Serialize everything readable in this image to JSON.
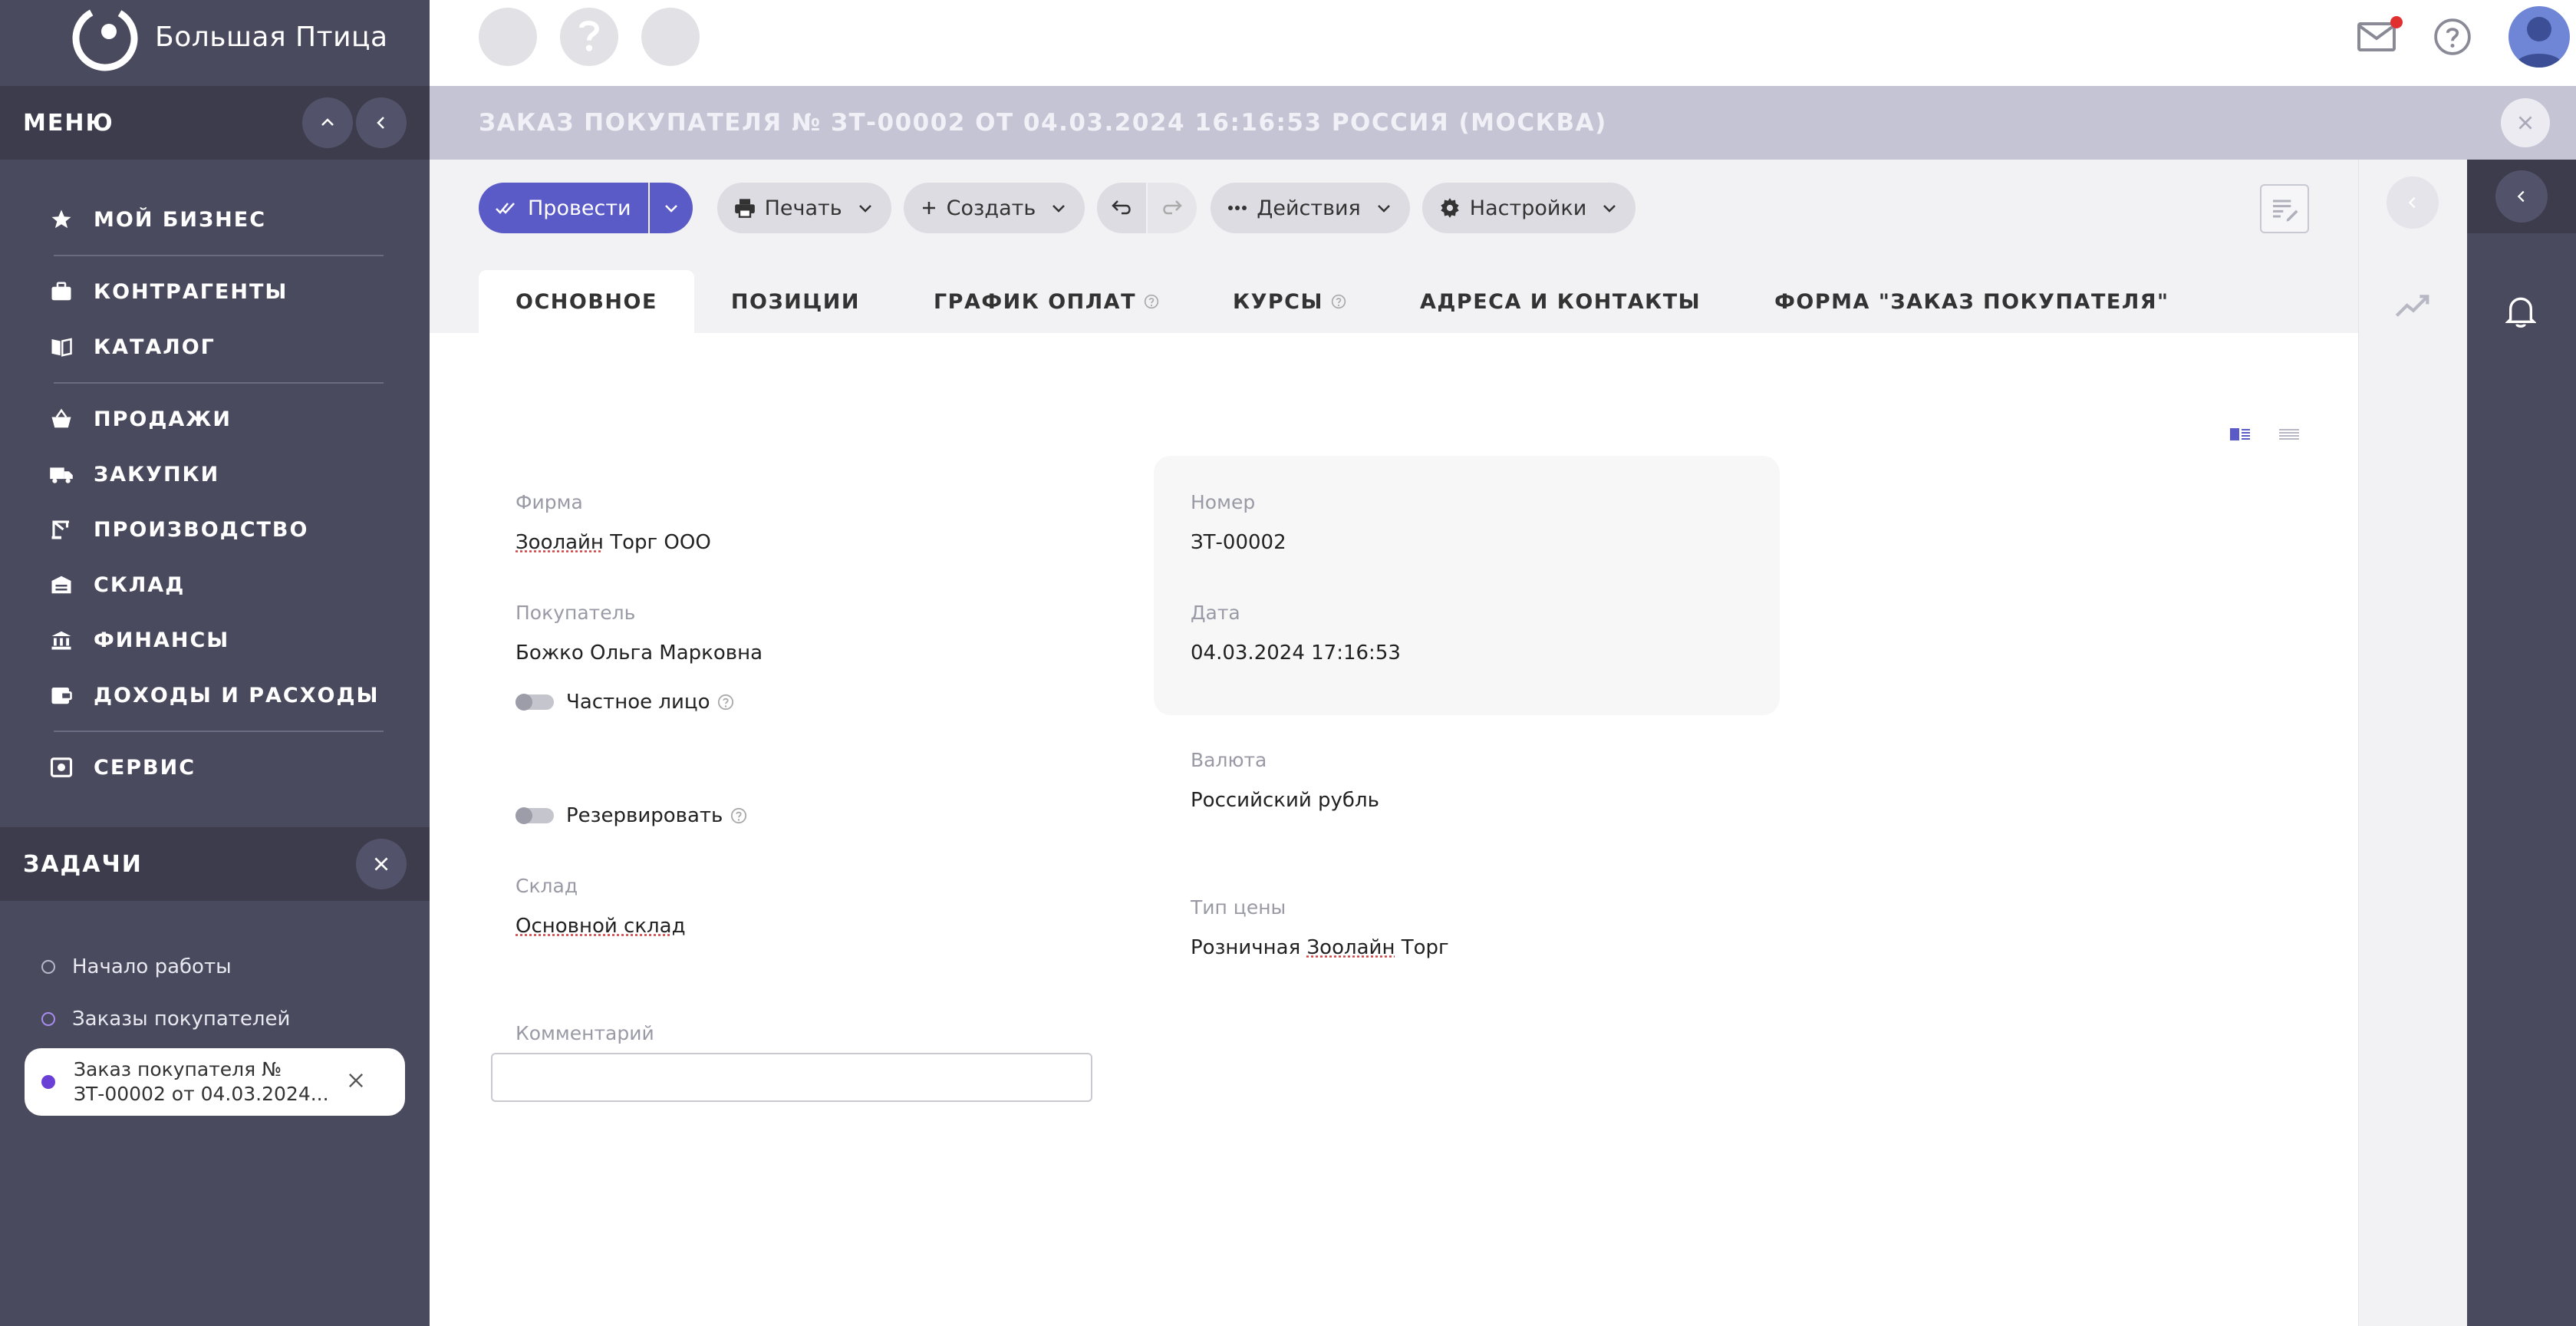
{
  "app": {
    "logo_text": "Большая Птица"
  },
  "menu": {
    "title": "МЕНЮ",
    "items": [
      {
        "label": "МОЙ БИЗНЕС",
        "icon": "star-icon"
      },
      {
        "label": "КОНТРАГЕНТЫ",
        "icon": "briefcase-icon"
      },
      {
        "label": "КАТАЛОГ",
        "icon": "book-icon"
      },
      {
        "label": "ПРОДАЖИ",
        "icon": "basket-icon"
      },
      {
        "label": "ЗАКУПКИ",
        "icon": "truck-icon"
      },
      {
        "label": "ПРОИЗВОДСТВО",
        "icon": "crane-icon"
      },
      {
        "label": "СКЛАД",
        "icon": "warehouse-icon"
      },
      {
        "label": "ФИНАНСЫ",
        "icon": "bank-icon"
      },
      {
        "label": "ДОХОДЫ И РАСХОДЫ",
        "icon": "wallet-icon"
      },
      {
        "label": "СЕРВИС",
        "icon": "service-icon"
      }
    ]
  },
  "tasks": {
    "title": "ЗАДАЧИ",
    "items": [
      {
        "label": "Начало работы"
      },
      {
        "label": "Заказы покупателей"
      }
    ],
    "active": {
      "label": "Заказ покупателя № ЗТ-00002 от 04.03.2024..."
    }
  },
  "document": {
    "title": "ЗАКАЗ ПОКУПАТЕЛЯ № ЗТ-00002 ОТ 04.03.2024 16:16:53 РОССИЯ (МОСКВА)"
  },
  "toolbar": {
    "post_label": "Провести",
    "print_label": "Печать",
    "create_label": "Создать",
    "actions_label": "Действия",
    "settings_label": "Настройки"
  },
  "tabs": [
    {
      "label": "ОСНОВНОЕ",
      "active": true
    },
    {
      "label": "ПОЗИЦИИ"
    },
    {
      "label": "ГРАФИК ОПЛАТ"
    },
    {
      "label": "КУРСЫ"
    },
    {
      "label": "АДРЕСА И КОНТАКТЫ"
    },
    {
      "label": "ФОРМА \"ЗАКАЗ ПОКУПАТЕЛЯ\""
    }
  ],
  "form": {
    "firm_label": "Фирма",
    "firm_value_a": "Зоолайн",
    "firm_value_b": " Торг ООО",
    "buyer_label": "Покупатель",
    "buyer_value": "Божко Ольга Марковна",
    "private_label": "Частное лицо",
    "reserve_label": "Резервировать",
    "warehouse_label": "Склад",
    "warehouse_value": "Основной склад",
    "comment_label": "Комментарий",
    "comment_value": "",
    "number_label": "Номер",
    "number_value": "ЗТ-00002",
    "date_label": "Дата",
    "date_value": "04.03.2024 17:16:53",
    "currency_label": "Валюта",
    "currency_value": "Российский рубль",
    "price_type_label": "Тип цены",
    "price_type_value_a": "Розничная ",
    "price_type_value_b": "Зоолайн",
    "price_type_value_c": " Торг"
  },
  "colors": {
    "sidebar": "#4a4a5e",
    "sidebar_dark": "#3c3c4c",
    "accent": "#5b5bc8",
    "title_bar": "#c5c4d4",
    "notification_dot": "#e03030"
  }
}
